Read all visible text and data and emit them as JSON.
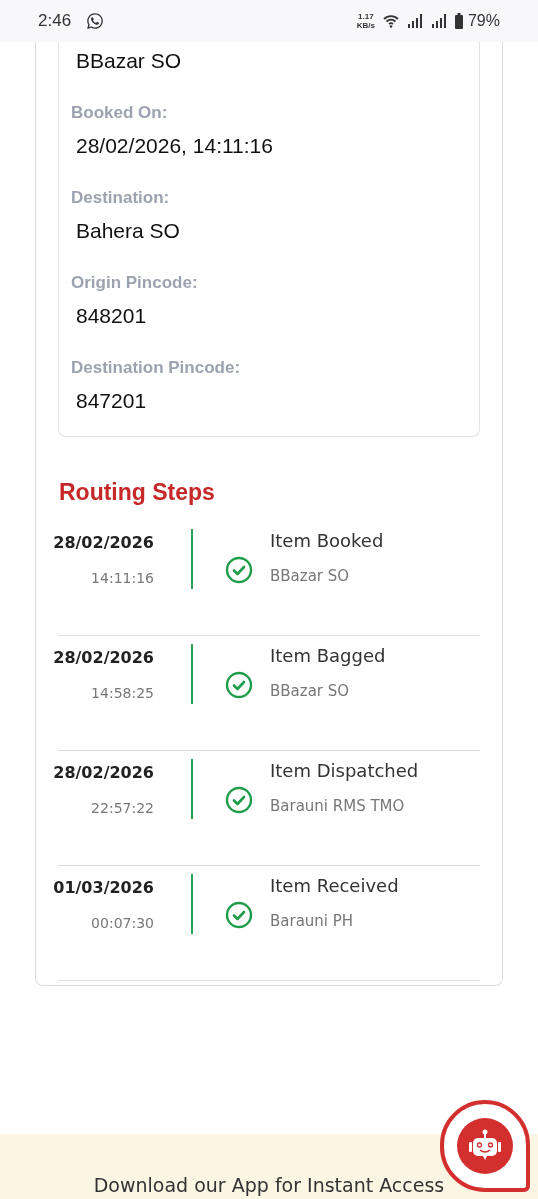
{
  "status_bar": {
    "time": "2:46",
    "speed_value": "1.17",
    "speed_unit": "KB/s",
    "battery": "79%"
  },
  "details": [
    {
      "value": "BBazar SO"
    },
    {
      "label": "Booked On:",
      "value": "28/02/2026, 14:11:16"
    },
    {
      "label": "Destination:",
      "value": "Bahera SO"
    },
    {
      "label": "Origin Pincode:",
      "value": "848201"
    },
    {
      "label": "Destination Pincode:",
      "value": "847201"
    }
  ],
  "routing": {
    "title": "Routing Steps",
    "steps": [
      {
        "date": "28/02/2026",
        "time": "14:11:16",
        "event": "Item Booked",
        "office": "BBazar SO",
        "done": true
      },
      {
        "date": "28/02/2026",
        "time": "14:58:25",
        "event": "Item Bagged",
        "office": "BBazar SO",
        "done": true
      },
      {
        "date": "28/02/2026",
        "time": "22:57:22",
        "event": "Item Dispatched",
        "office": "Barauni RMS TMO",
        "done": true
      },
      {
        "date": "01/03/2026",
        "time": "00:07:30",
        "event": "Item Received",
        "office": "Barauni PH",
        "done": true
      }
    ]
  },
  "footer": {
    "text": "Download our App for Instant Access"
  }
}
